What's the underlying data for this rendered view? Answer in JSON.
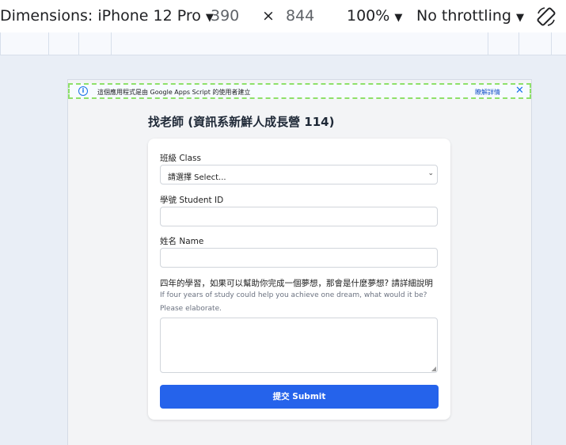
{
  "devtools": {
    "dimensions_label": "Dimensions: iPhone 12 Pro",
    "width": "390",
    "times": "×",
    "height": "844",
    "zoom": "100%",
    "throttle": "No throttling",
    "dropdown_glyph": "▼",
    "rotate_icon": "rotate-icon"
  },
  "banner": {
    "message": "這個應用程式是由 Google Apps Script 的使用者建立",
    "details": "瞭解詳情",
    "close": "✕",
    "info": "i"
  },
  "form": {
    "title": "找老師 (資訊系新鮮人成長營 114)",
    "class_label": "班級 Class",
    "class_value": "請選擇 Select...",
    "student_id_label": "學號 Student ID",
    "name_label": "姓名 Name",
    "question_label": "四年的學習，如果可以幫助你完成一個夢想，那會是什麼夢想? 請詳細說明",
    "question_hint": "If four years of study could help you achieve one dream, what would it be? Please elaborate.",
    "submit_label": "提交 Submit",
    "chevron": "⌄"
  },
  "colors": {
    "accent": "#2563eb",
    "banner_outline": "#8ee06a"
  }
}
